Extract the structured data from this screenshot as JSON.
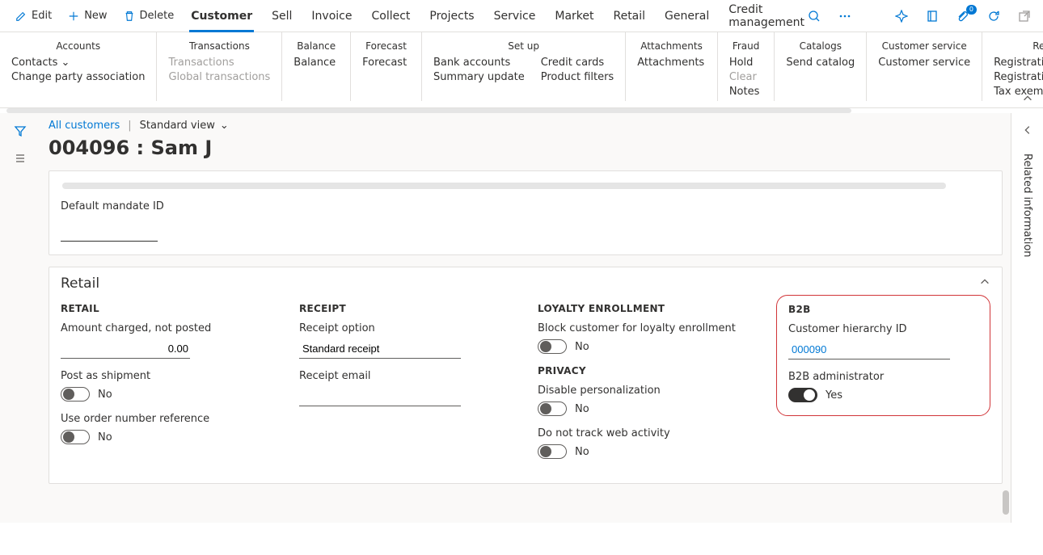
{
  "cmdbar": {
    "edit": "Edit",
    "new": "New",
    "delete": "Delete"
  },
  "tabs": [
    "Customer",
    "Sell",
    "Invoice",
    "Collect",
    "Projects",
    "Service",
    "Market",
    "Retail",
    "General",
    "Credit management"
  ],
  "active_tab_index": 0,
  "header_icons": {
    "search": "search-icon",
    "more": "more-icon",
    "diamond": "copilot-icon",
    "office": "office-icon",
    "attach": "attachments-icon",
    "attach_badge": "0",
    "refresh": "refresh-icon",
    "popout": "popout-icon",
    "close": "close-icon"
  },
  "ribbon": [
    {
      "title": "Accounts",
      "items": [
        {
          "label": "Contacts",
          "dropdown": true
        },
        {
          "label": "Change party association"
        }
      ]
    },
    {
      "title": "Transactions",
      "items": [
        {
          "label": "Transactions",
          "disabled": true
        },
        {
          "label": "Global transactions",
          "disabled": true
        }
      ]
    },
    {
      "title": "Balance",
      "items": [
        {
          "label": "Balance"
        }
      ]
    },
    {
      "title": "Forecast",
      "items": [
        {
          "label": "Forecast"
        }
      ]
    },
    {
      "title": "Set up",
      "items": [
        {
          "label": "Bank accounts"
        },
        {
          "label": "Summary update"
        },
        {
          "label": "Credit cards"
        },
        {
          "label": "Product filters"
        }
      ]
    },
    {
      "title": "Attachments",
      "items": [
        {
          "label": "Attachments"
        }
      ]
    },
    {
      "title": "Fraud",
      "items": [
        {
          "label": "Hold"
        },
        {
          "label": "Clear",
          "disabled": true
        },
        {
          "label": "Notes"
        }
      ]
    },
    {
      "title": "Catalogs",
      "items": [
        {
          "label": "Send catalog"
        }
      ]
    },
    {
      "title": "Customer service",
      "items": [
        {
          "label": "Customer service"
        }
      ]
    },
    {
      "title": "Registration",
      "items": [
        {
          "label": "Registration IDs"
        },
        {
          "label": "Registration ID search"
        },
        {
          "label": "Tax exempt number searc"
        }
      ]
    }
  ],
  "breadcrumb": {
    "link": "All customers",
    "view": "Standard view"
  },
  "page_title": "004096 : Sam J",
  "prev_section": {
    "default_mandate_label": "Default mandate ID",
    "default_mandate_value": ""
  },
  "retail_section": {
    "title": "Retail",
    "retail": {
      "head": "RETAIL",
      "amount_label": "Amount charged, not posted",
      "amount_value": "0.00",
      "post_label": "Post as shipment",
      "post_value": "No",
      "useorder_label": "Use order number reference",
      "useorder_value": "No"
    },
    "receipt": {
      "head": "RECEIPT",
      "option_label": "Receipt option",
      "option_value": "Standard receipt",
      "email_label": "Receipt email",
      "email_value": ""
    },
    "loyalty": {
      "head": "LOYALTY ENROLLMENT",
      "block_label": "Block customer for loyalty enrollment",
      "block_value": "No"
    },
    "privacy": {
      "head": "PRIVACY",
      "disable_label": "Disable personalization",
      "disable_value": "No",
      "dnt_label": "Do not track web activity",
      "dnt_value": "No"
    },
    "b2b": {
      "head": "B2B",
      "hierarchy_label": "Customer hierarchy ID",
      "hierarchy_value": "000090",
      "admin_label": "B2B administrator",
      "admin_value": "Yes"
    }
  },
  "rightrail": {
    "related": "Related information"
  }
}
